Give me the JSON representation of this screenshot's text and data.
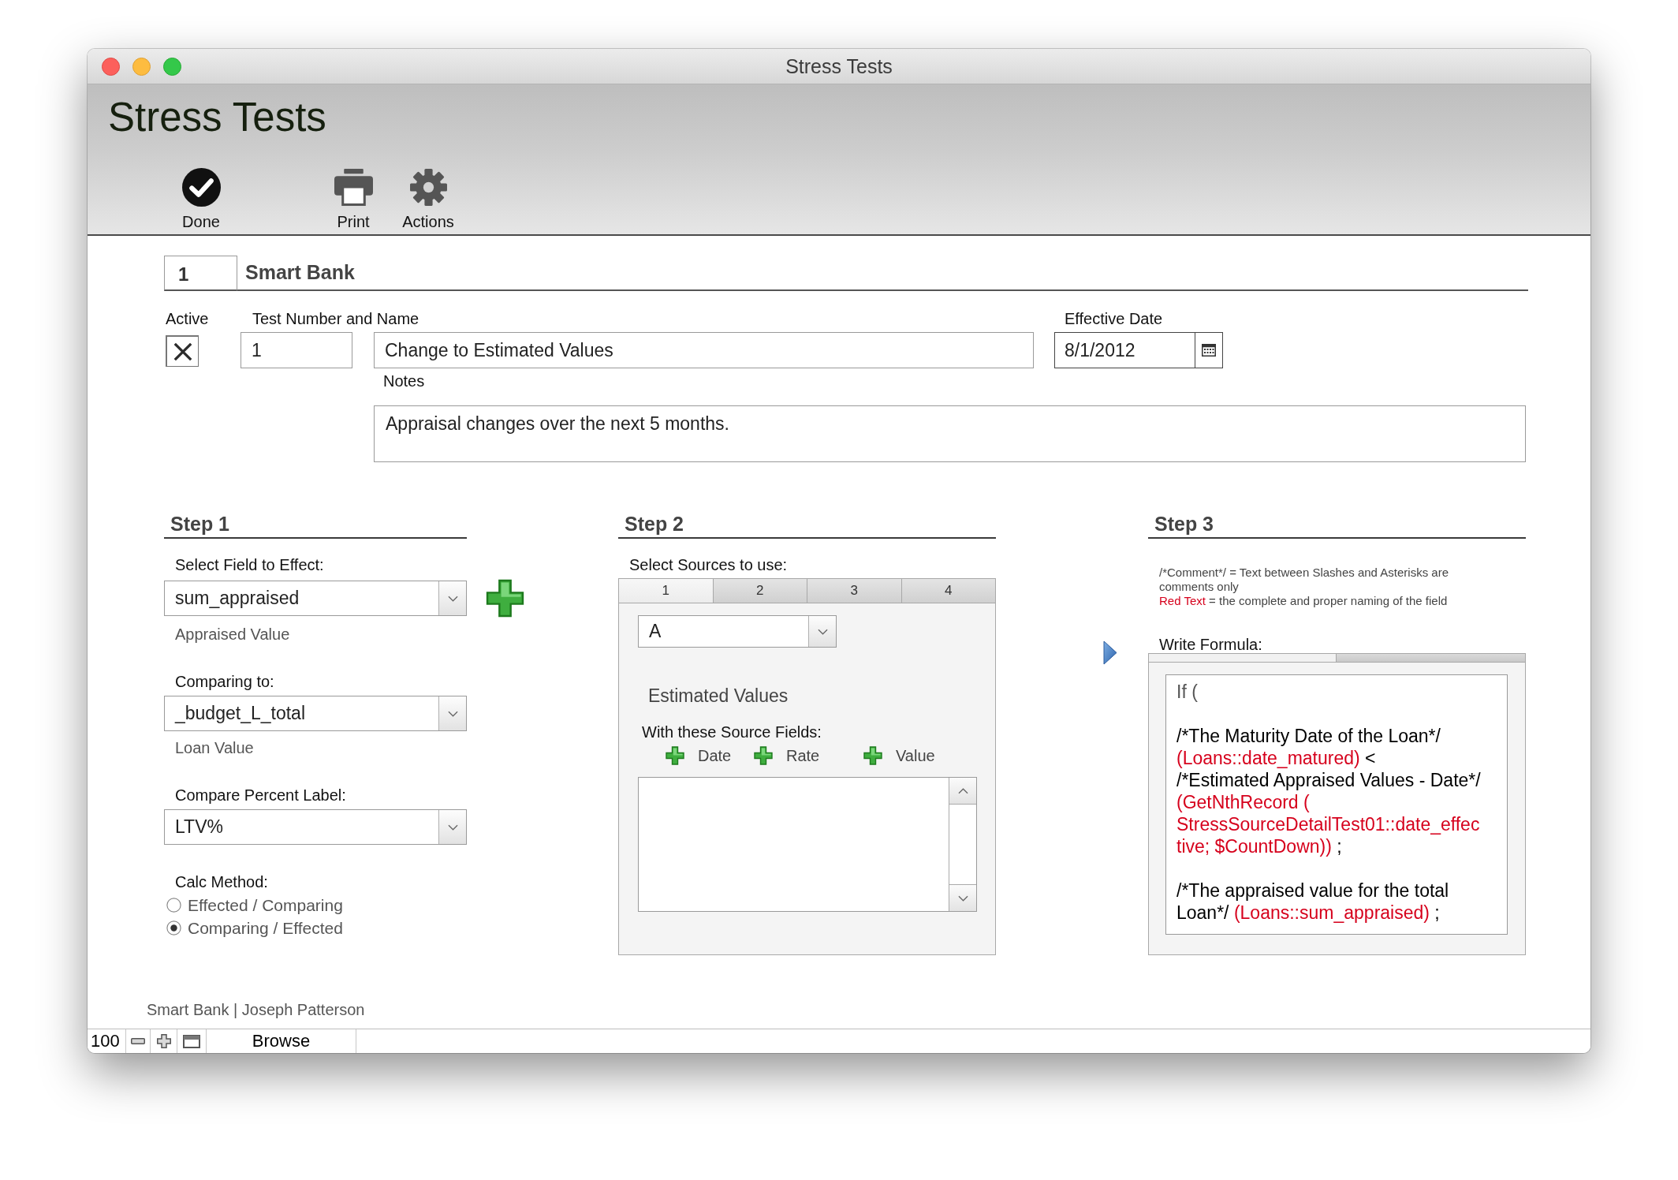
{
  "window": {
    "title": "Stress Tests"
  },
  "header": {
    "title": "Stress Tests"
  },
  "toolbar": [
    {
      "kind": "done",
      "label": "Done"
    },
    {
      "kind": "print",
      "label": "Print"
    },
    {
      "kind": "actions",
      "label": "Actions"
    }
  ],
  "record": {
    "number": "1",
    "name": "Smart Bank"
  },
  "test": {
    "active_label": "Active",
    "active": true,
    "number_label": "Test Number and Name",
    "number": "1",
    "name": "Change to Estimated Values",
    "date_label": "Effective Date",
    "date": "8/1/2012",
    "notes_label": "Notes",
    "notes": "Appraisal changes over the next 5 months."
  },
  "step1": {
    "title": "Step 1",
    "fields": [
      {
        "label": "Select Field to Effect:",
        "value": "sum_appraised",
        "caption": "Appraised Value",
        "add_button": true
      },
      {
        "label": "Comparing to:",
        "value": "_budget_L_total",
        "caption": "Loan Value",
        "add_button": false
      },
      {
        "label": "Compare Percent Label:",
        "value": "LTV%",
        "add_button": false
      }
    ],
    "calc_label": "Calc Method:",
    "calc_options": [
      {
        "label": "Effected / Comparing",
        "selected": false
      },
      {
        "label": "Comparing / Effected",
        "selected": true
      }
    ]
  },
  "step2": {
    "title": "Step 2",
    "label": "Select Sources to use:",
    "tabs": [
      {
        "label": "1",
        "selected": true
      },
      {
        "label": "2",
        "selected": false
      },
      {
        "label": "3",
        "selected": false
      },
      {
        "label": "4",
        "selected": false
      }
    ],
    "source": "A",
    "source_name": "Estimated Values",
    "fields_label": "With these Source Fields:",
    "source_fields": [
      "Date",
      "Rate",
      "Value"
    ]
  },
  "step3": {
    "title": "Step 3",
    "legend": [
      [
        {
          "kind": "text",
          "text": "/*Comment*/ = Text between Slashes and Asterisks are comments only"
        }
      ],
      [
        {
          "kind": "field",
          "text": "Red Text"
        },
        {
          "kind": "text",
          "text": " = the complete and proper naming of the field"
        }
      ]
    ],
    "formula_label": "Write Formula:",
    "formula_tabs": [
      {
        "selected": true
      },
      {
        "selected": false
      }
    ],
    "formula": [
      [
        [
          {
            "kind": "keyword",
            "text": "If ("
          }
        ]
      ],
      [
        [
          {
            "kind": "comment",
            "text": "/*The Maturity Date of the Loan*/"
          }
        ],
        [
          {
            "kind": "field",
            "text": "(Loans::date_matured)"
          },
          {
            "kind": "operator",
            "text": " <"
          }
        ],
        [
          {
            "kind": "comment",
            "text": "/*Estimated Appraised Values - Date*/"
          }
        ],
        [
          {
            "kind": "field",
            "text": "(GetNthRecord ("
          }
        ],
        [
          {
            "kind": "field",
            "text": "StressSourceDetailTest01::date_effec"
          }
        ],
        [
          {
            "kind": "field",
            "text": "tive; $CountDown))"
          },
          {
            "kind": "operator",
            "text": " ;"
          }
        ]
      ],
      [
        [
          {
            "kind": "comment",
            "text": "/*The appraised value for the total"
          }
        ],
        [
          {
            "kind": "comment",
            "text": "Loan*/"
          },
          {
            "kind": "field",
            "text": " (Loans::sum_appraised)"
          },
          {
            "kind": "operator",
            "text": " ;"
          }
        ]
      ]
    ]
  },
  "footer": {
    "text": "Smart Bank | Joseph Patterson"
  },
  "status_bar": {
    "zoom": "100",
    "mode": "Browse"
  }
}
